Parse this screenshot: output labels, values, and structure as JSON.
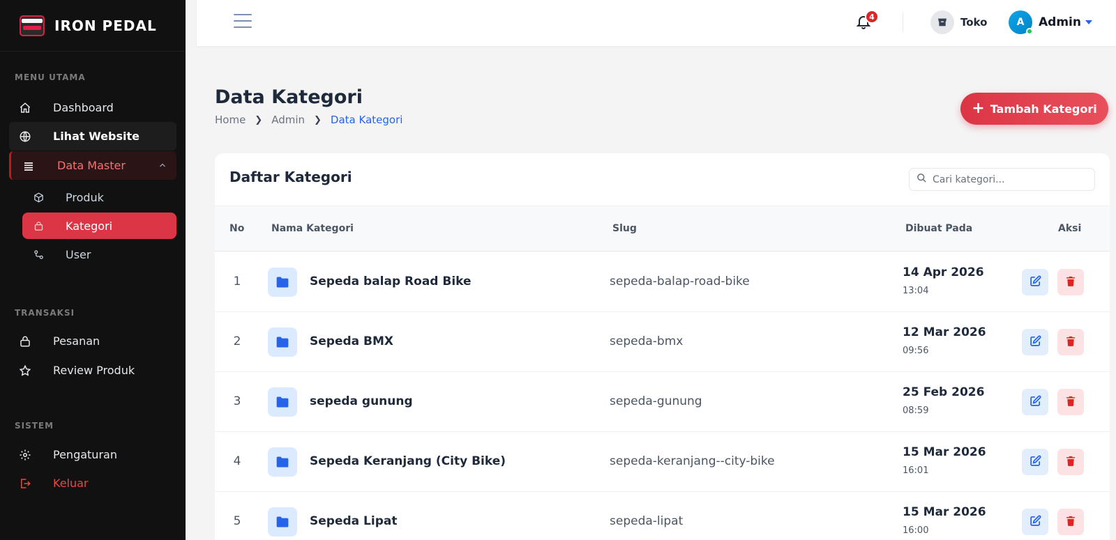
{
  "brand": {
    "name": "IRON PEDAL"
  },
  "sidebar": {
    "sections": {
      "main": "MENU UTAMA",
      "transactions": "TRANSAKSI",
      "system": "SISTEM"
    },
    "items": {
      "dashboard": "Dashboard",
      "website": "Lihat Website",
      "data_master": "Data Master",
      "produk": "Produk",
      "kategori": "Kategori",
      "user": "User",
      "pesanan": "Pesanan",
      "review": "Review Produk",
      "pengaturan": "Pengaturan",
      "keluar": "Keluar"
    }
  },
  "topbar": {
    "notification_count": "4",
    "store_label": "Toko",
    "avatar_initial": "A",
    "user_name": "Admin"
  },
  "page": {
    "title": "Data Kategori",
    "breadcrumb": [
      "Home",
      "Admin",
      "Data Kategori"
    ],
    "add_button": "Tambah Kategori"
  },
  "card": {
    "title": "Daftar Kategori",
    "search_placeholder": "Cari kategori..."
  },
  "table": {
    "headers": {
      "no": "No",
      "name": "Nama Kategori",
      "slug": "Slug",
      "created": "Dibuat Pada",
      "action": "Aksi"
    },
    "rows": [
      {
        "no": "1",
        "name": "Sepeda balap Road Bike",
        "slug": "sepeda-balap-road-bike",
        "date": "14 Apr 2026",
        "time": "13:04"
      },
      {
        "no": "2",
        "name": "Sepeda BMX",
        "slug": "sepeda-bmx",
        "date": "12 Mar 2026",
        "time": "09:56"
      },
      {
        "no": "3",
        "name": "sepeda gunung",
        "slug": "sepeda-gunung",
        "date": "25 Feb 2026",
        "time": "08:59"
      },
      {
        "no": "4",
        "name": "Sepeda Keranjang (City Bike)",
        "slug": "sepeda-keranjang--city-bike",
        "date": "15 Mar 2026",
        "time": "16:01"
      },
      {
        "no": "5",
        "name": "Sepeda Lipat",
        "slug": "sepeda-lipat",
        "date": "15 Mar 2026",
        "time": "16:00"
      }
    ]
  },
  "colors": {
    "accent_red": "#dc3545",
    "link_blue": "#2563eb",
    "sidebar_bg": "#111111"
  }
}
